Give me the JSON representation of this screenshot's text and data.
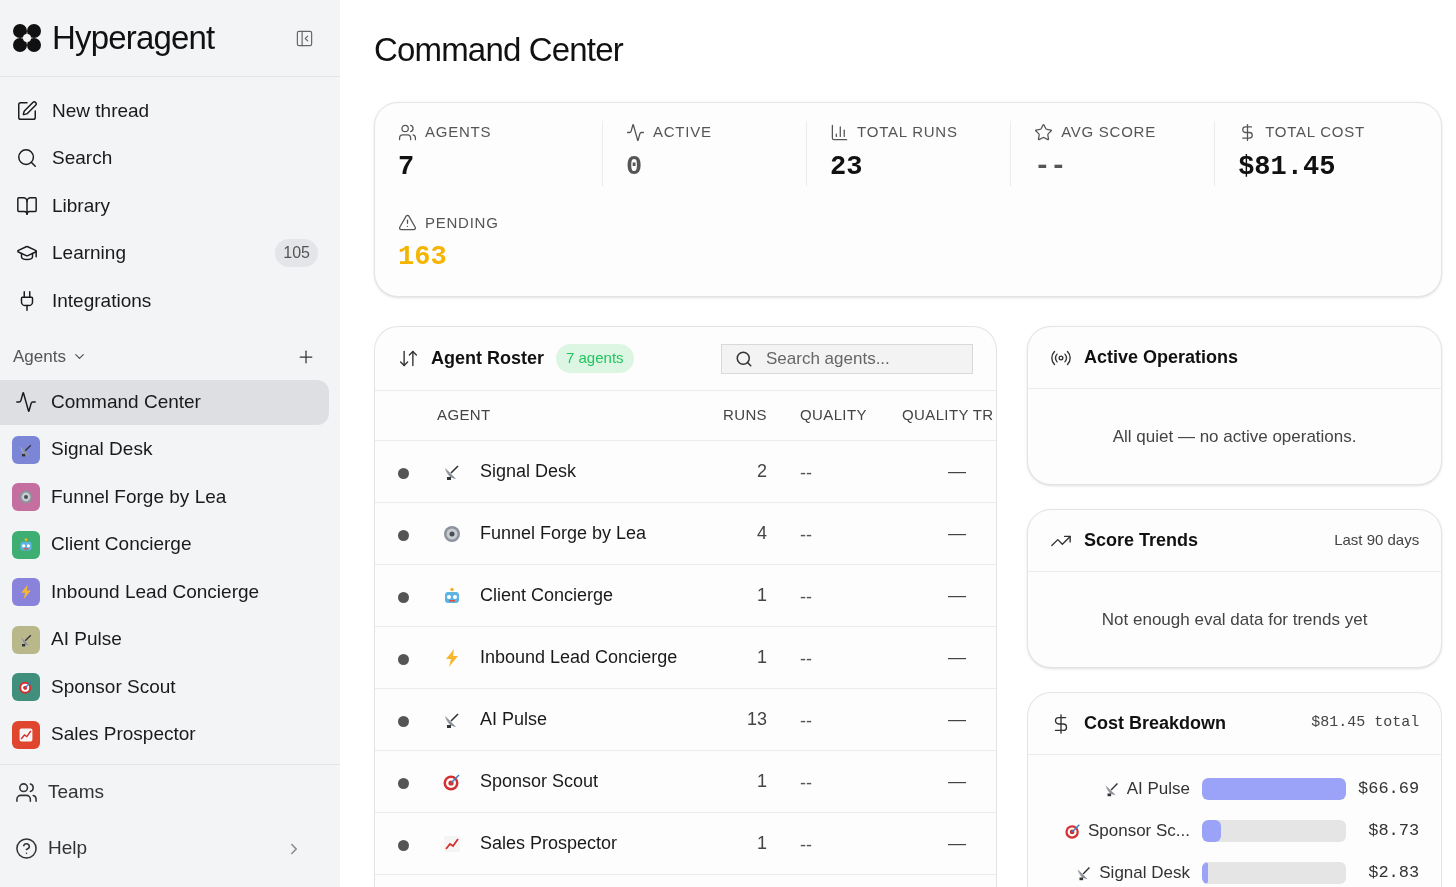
{
  "sidebar": {
    "brand": "Hyperagent",
    "nav": [
      {
        "label": "New thread",
        "kind": "pen"
      },
      {
        "label": "Search",
        "kind": "search"
      },
      {
        "label": "Library",
        "kind": "book"
      },
      {
        "label": "Learning",
        "kind": "cap",
        "count": "105"
      },
      {
        "label": "Integrations",
        "kind": "plug"
      }
    ],
    "section": "Agents",
    "agents": [
      {
        "label": "Command Center",
        "kind": "pulse",
        "selected": true
      },
      {
        "label": "Signal Desk",
        "kind": "satellite",
        "color": "#7b86d6",
        "selected": false
      },
      {
        "label": "Funnel Forge by Lea",
        "kind": "gear",
        "color": "#c46fa0",
        "selected": false
      },
      {
        "label": "Client Concierge",
        "kind": "robot",
        "color": "#3fae72",
        "selected": false
      },
      {
        "label": "Inbound Lead Concierge",
        "kind": "bolt",
        "color": "#8a83dc",
        "selected": false
      },
      {
        "label": "AI Pulse",
        "kind": "satellite",
        "color": "#b9b88a",
        "selected": false
      },
      {
        "label": "Sponsor Scout",
        "kind": "target",
        "color": "#3f8f7c",
        "selected": false
      },
      {
        "label": "Sales Prospector",
        "kind": "chart",
        "color": "#e0452e",
        "selected": false
      }
    ],
    "footer": [
      {
        "label": "Teams",
        "kind": "users"
      },
      {
        "label": "Help",
        "kind": "help"
      }
    ]
  },
  "title": "Command Center",
  "stats": [
    {
      "label": "AGENTS",
      "kind": "users",
      "value": "7",
      "color": "#111111"
    },
    {
      "label": "ACTIVE",
      "kind": "pulse",
      "value": "0",
      "color": "#555555"
    },
    {
      "label": "TOTAL RUNS",
      "kind": "bars",
      "value": "23",
      "color": "#111111"
    },
    {
      "label": "AVG SCORE",
      "kind": "star",
      "value": "--",
      "color": "#555555"
    },
    {
      "label": "TOTAL COST",
      "kind": "dollar",
      "value": "$81.45",
      "color": "#111111"
    },
    {
      "label": "PENDING",
      "kind": "alert",
      "value": "163",
      "color": "#f5b400"
    }
  ],
  "roster": {
    "title": "Agent Roster",
    "badge": "7 agents",
    "search": {
      "placeholder": "Search agents..."
    },
    "columns": [
      "AGENT",
      "RUNS",
      "QUALITY",
      "QUALITY TR"
    ],
    "rows": [
      {
        "name": "Signal Desk",
        "kind": "satellite",
        "runs": "2",
        "quality": "--",
        "trend": "—"
      },
      {
        "name": "Funnel Forge by Lea",
        "kind": "gear",
        "runs": "4",
        "quality": "--",
        "trend": "—"
      },
      {
        "name": "Client Concierge",
        "kind": "robot",
        "runs": "1",
        "quality": "--",
        "trend": "—"
      },
      {
        "name": "Inbound Lead Concierge",
        "kind": "bolt",
        "runs": "1",
        "quality": "--",
        "trend": "—"
      },
      {
        "name": "AI Pulse",
        "kind": "satellite",
        "runs": "13",
        "quality": "--",
        "trend": "—"
      },
      {
        "name": "Sponsor Scout",
        "kind": "target",
        "runs": "1",
        "quality": "--",
        "trend": "—"
      },
      {
        "name": "Sales Prospector",
        "kind": "chart",
        "runs": "1",
        "quality": "--",
        "trend": "—"
      }
    ]
  },
  "active_operations": {
    "title": "Active Operations",
    "message": "All quiet — no active operations."
  },
  "score_trends": {
    "title": "Score Trends",
    "range": "Last 90 days",
    "message": "Not enough eval data for trends yet"
  },
  "cost_breakdown": {
    "title": "Cost Breakdown",
    "total": "$81.45 total",
    "items": [
      {
        "name": "AI Pulse",
        "kind": "satellite",
        "level": 1,
        "amount": "$66.69"
      },
      {
        "name": "Sponsor Sc...",
        "kind": "target",
        "level": 0.13,
        "amount": "$8.73"
      },
      {
        "name": "Signal Desk",
        "kind": "satellite",
        "level": 0.04,
        "amount": "$2.83"
      }
    ]
  }
}
